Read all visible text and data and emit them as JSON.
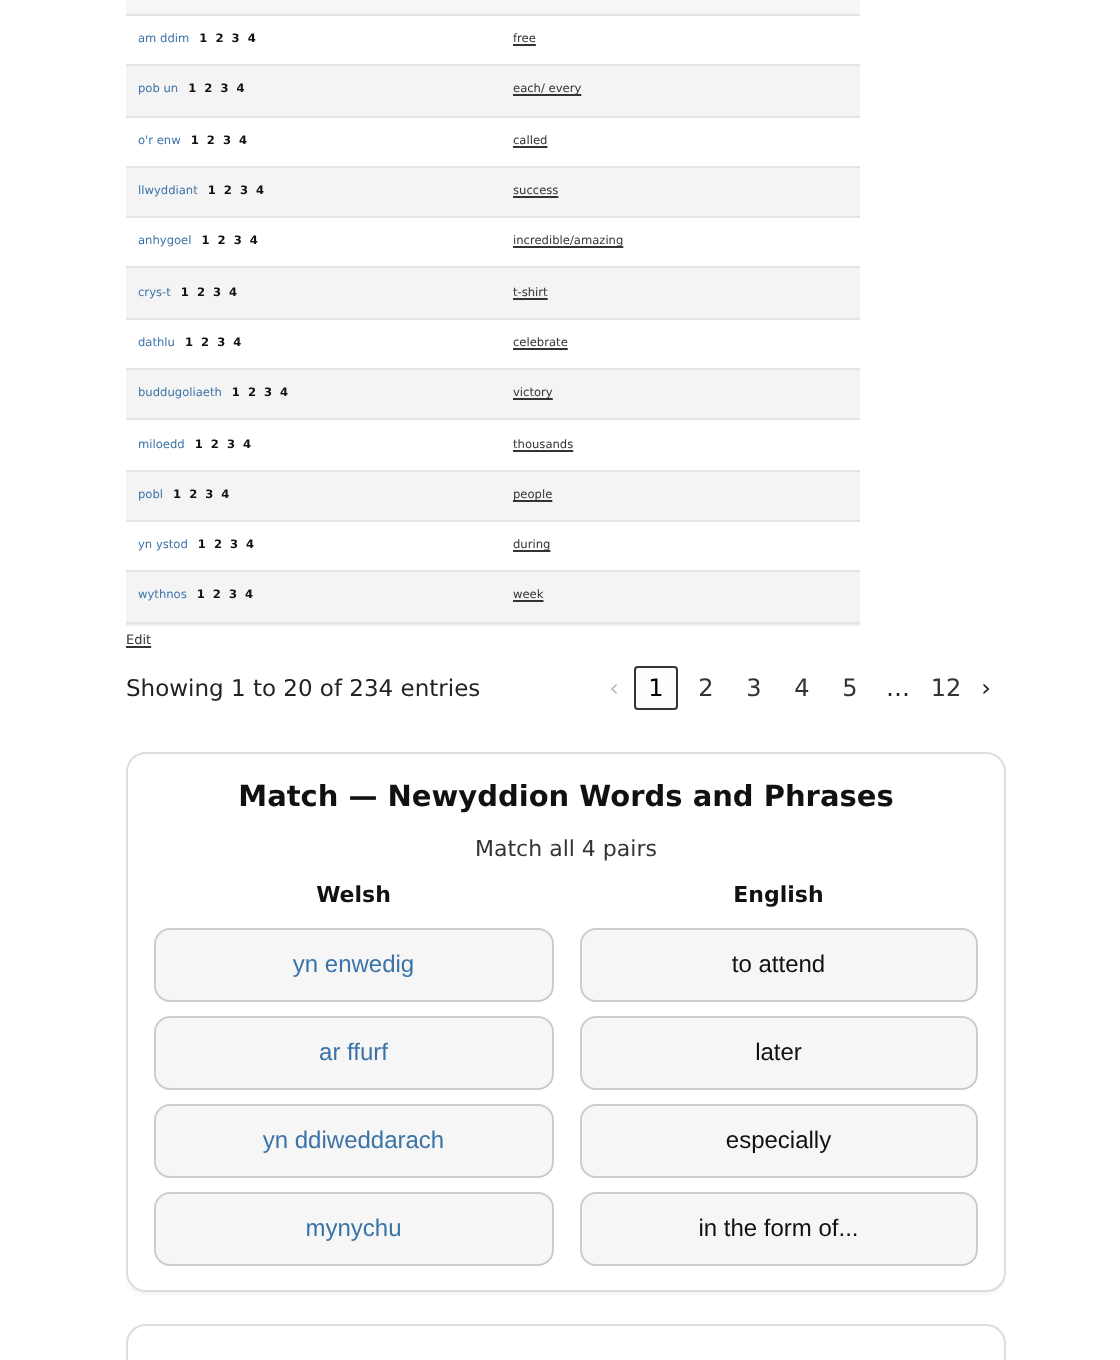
{
  "vocab_table": {
    "rows": [
      {
        "welsh": "am ddim",
        "audio": [
          "1",
          "2",
          "3",
          "4"
        ],
        "english": "free"
      },
      {
        "welsh": "pob un",
        "audio": [
          "1",
          "2",
          "3",
          "4"
        ],
        "english": "each/ every"
      },
      {
        "welsh": "o'r enw",
        "audio": [
          "1",
          "2",
          "3",
          "4"
        ],
        "english": "called"
      },
      {
        "welsh": "llwyddiant",
        "audio": [
          "1",
          "2",
          "3",
          "4"
        ],
        "english": "success"
      },
      {
        "welsh": "anhygoel",
        "audio": [
          "1",
          "2",
          "3",
          "4"
        ],
        "english": "incredible/amazing"
      },
      {
        "welsh": "crys-t",
        "audio": [
          "1",
          "2",
          "3",
          "4"
        ],
        "english": "t-shirt"
      },
      {
        "welsh": "dathlu",
        "audio": [
          "1",
          "2",
          "3",
          "4"
        ],
        "english": "celebrate"
      },
      {
        "welsh": "buddugoliaeth",
        "audio": [
          "1",
          "2",
          "3",
          "4"
        ],
        "english": "victory"
      },
      {
        "welsh": "miloedd",
        "audio": [
          "1",
          "2",
          "3",
          "4"
        ],
        "english": "thousands"
      },
      {
        "welsh": "pobl",
        "audio": [
          "1",
          "2",
          "3",
          "4"
        ],
        "english": "people"
      },
      {
        "welsh": "yn ystod",
        "audio": [
          "1",
          "2",
          "3",
          "4"
        ],
        "english": "during"
      },
      {
        "welsh": "wythnos",
        "audio": [
          "1",
          "2",
          "3",
          "4"
        ],
        "english": "week"
      }
    ]
  },
  "edit_link": "Edit",
  "entries_info": "Showing 1 to 20 of 234 entries",
  "pagination": {
    "previous": {
      "label": "‹",
      "disabled": true
    },
    "next": {
      "label": "›",
      "disabled": false
    },
    "pages": [
      {
        "label": "1",
        "kind": "page",
        "selected": true
      },
      {
        "label": "2",
        "kind": "page",
        "selected": false
      },
      {
        "label": "3",
        "kind": "page",
        "selected": false
      },
      {
        "label": "4",
        "kind": "page",
        "selected": false
      },
      {
        "label": "5",
        "kind": "page",
        "selected": false
      },
      {
        "label": "…",
        "kind": "ellipsis"
      },
      {
        "label": "12",
        "kind": "page",
        "selected": false
      }
    ]
  },
  "match_game": {
    "title": "Match — Newyddion Words and Phrases",
    "subtitle": "Match all 4 pairs",
    "columns": [
      {
        "heading": "Welsh",
        "kind": "source",
        "items": [
          "yn enwedig",
          "ar ffurf",
          "yn ddiweddarach",
          "mynychu"
        ]
      },
      {
        "heading": "English",
        "kind": "target",
        "items": [
          "to attend",
          "later",
          "especially",
          "in the form of..."
        ]
      }
    ]
  }
}
